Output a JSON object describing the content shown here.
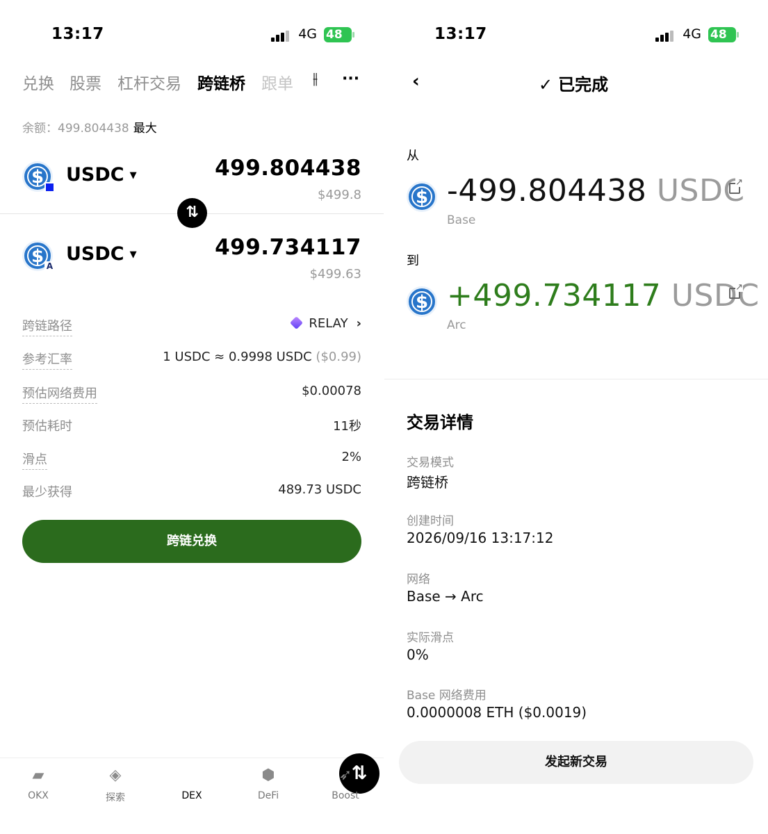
{
  "left": {
    "status": {
      "time": "13:17",
      "network": "4G",
      "battery": "48"
    },
    "tabs": [
      "兑换",
      "股票",
      "杠杆交易",
      "跨链桥",
      "跟单"
    ],
    "active_tab": "跨链桥",
    "balance": {
      "label": "余额：",
      "value": "499.804438",
      "max": "最大"
    },
    "from": {
      "token": "USDC",
      "amount": "499.804438",
      "usd": "$499.8"
    },
    "to": {
      "token": "USDC",
      "amount": "499.734117",
      "usd": "$499.63"
    },
    "details": {
      "route_label": "跨链路径",
      "route_value": "RELAY",
      "rate_label": "参考汇率",
      "rate_value": "1 USDC ≈ 0.9998 USDC",
      "rate_usd": "($0.99)",
      "fee_label": "预估网络费用",
      "fee_value": "$0.00078",
      "time_label": "预估耗时",
      "time_value": "11秒",
      "slip_label": "滑点",
      "slip_value": "2%",
      "min_label": "最少获得",
      "min_value": "489.73 USDC"
    },
    "action_button": "跨链兑换",
    "nav": [
      "OKX",
      "探索",
      "DEX",
      "DeFi",
      "Boost"
    ]
  },
  "right": {
    "status": {
      "time": "13:17",
      "network": "4G",
      "battery": "48"
    },
    "header": "已完成",
    "from_label": "从",
    "from_amount": "-499.804438",
    "from_symbol": "USDC",
    "from_chain": "Base",
    "to_label": "到",
    "to_amount": "+499.734117",
    "to_symbol": "USDC",
    "to_chain": "Arc",
    "section_title": "交易详情",
    "details": [
      {
        "label": "交易模式",
        "value": "跨链桥"
      },
      {
        "label": "创建时间",
        "value": "2026/09/16 13:17:12"
      },
      {
        "label": "网络",
        "value": "Base → Arc"
      },
      {
        "label": "实际滑点",
        "value": "0%"
      },
      {
        "label": "Base 网络费用",
        "value": "0.0000008 ETH ($0.0019)"
      }
    ],
    "new_button": "发起新交易"
  },
  "colors": {
    "green_button": "#2b6b1d",
    "positive": "#2e7d1c",
    "usdc": "#2775ca"
  }
}
